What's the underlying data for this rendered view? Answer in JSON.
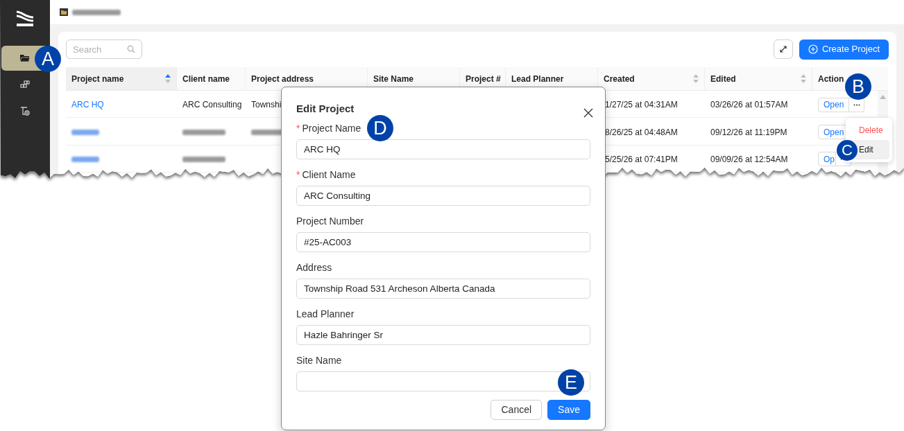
{
  "sidebar": {
    "items": [
      {
        "kind": "folder",
        "selected": true
      },
      {
        "kind": "blocks",
        "selected": false
      },
      {
        "kind": "tool",
        "selected": false
      }
    ]
  },
  "toolbar": {
    "search": {
      "placeholder": "Search"
    },
    "create_button": "Create Project"
  },
  "table": {
    "columns": [
      {
        "label": "Project name",
        "sortable": true,
        "sorted": true
      },
      {
        "label": "Client name"
      },
      {
        "label": "Project address"
      },
      {
        "label": "Site Name"
      },
      {
        "label": "Project #"
      },
      {
        "label": "Lead Planner"
      },
      {
        "label": "Created",
        "sortable": true,
        "sorted": false
      },
      {
        "label": "Edited",
        "sortable": true,
        "sorted": false
      },
      {
        "label": "Action"
      }
    ],
    "rows": [
      {
        "cells": [
          {
            "text": "ARC HQ",
            "kind": "link"
          },
          {
            "text": "ARC Consulting"
          },
          {
            "text": "Townshi"
          },
          null,
          null,
          null,
          {
            "text": "1/27/25 at 04:31AM"
          },
          {
            "text": "03/26/26 at 01:57AM"
          }
        ],
        "action": "Open",
        "more_button": true
      },
      {
        "cells": [
          {
            "blurred": true,
            "kind": "link"
          },
          {
            "blurred": true
          },
          {
            "blurred": true
          },
          null,
          null,
          null,
          {
            "text": "8/26/25 at 04:48AM"
          },
          {
            "text": "09/12/26 at 11:19PM"
          }
        ],
        "action": "Open",
        "more_button": false
      },
      {
        "cells": [
          {
            "blurred": true,
            "kind": "link"
          },
          {
            "blurred": true
          },
          null,
          null,
          null,
          null,
          {
            "text": "5/25/26 at 07:41PM"
          },
          {
            "text": "09/09/26 at 12:54AM"
          }
        ],
        "action": "Op",
        "more_button": true
      }
    ]
  },
  "row_menu": {
    "items": [
      {
        "label": "Delete",
        "kind": "danger",
        "hovered": false
      },
      {
        "label": "Edit",
        "kind": "normal",
        "hovered": true
      }
    ]
  },
  "modal": {
    "title": "Edit Project",
    "fields": [
      {
        "label": "Project Name",
        "required_mark": "*",
        "value": "ARC HQ"
      },
      {
        "label": "Client Name",
        "required_mark": "*",
        "value": "ARC Consulting"
      },
      {
        "label": "Project Number",
        "value": "#25-AC003"
      },
      {
        "label": "Address",
        "value": "Township Road 531 Archeson Alberta Canada"
      },
      {
        "label": "Lead Planner",
        "value": "Hazle Bahringer Sr"
      },
      {
        "label": "Site Name"
      }
    ],
    "buttons": [
      {
        "label": "Cancel",
        "kind": "secondary"
      },
      {
        "label": "Save",
        "kind": "primary"
      }
    ]
  },
  "callouts": [
    "A",
    "B",
    "C",
    "D",
    "E"
  ]
}
